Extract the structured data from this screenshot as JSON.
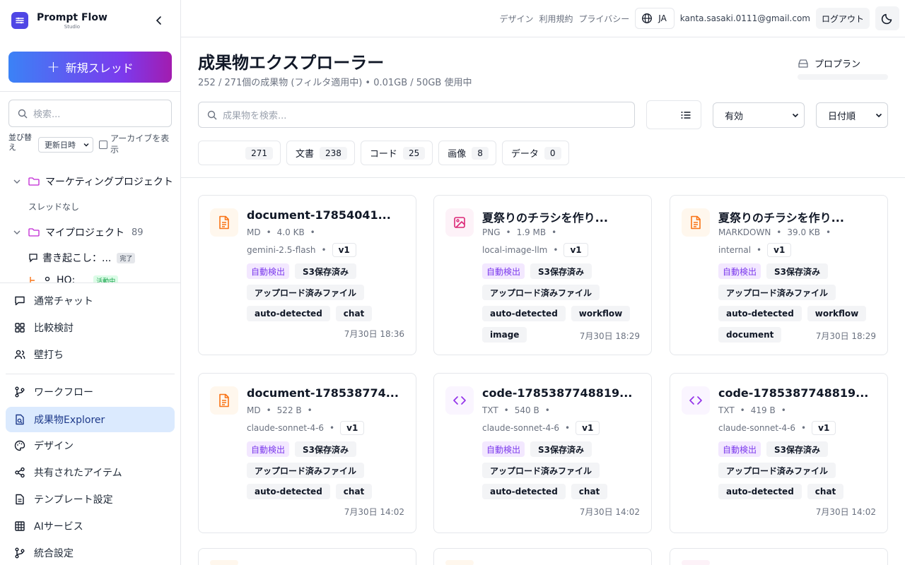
{
  "brand": {
    "title": "Prompt Flow",
    "subtitle": "Studio"
  },
  "sidebar": {
    "new_thread": "新規スレッド",
    "search_placeholder": "検索...",
    "sort_label": "並び替え",
    "sort_value": "更新日時",
    "archive_label": "アーカイブを表示",
    "tree": {
      "folder1": {
        "name": "マーケティングプロジェクト",
        "empty": "スレッドなし"
      },
      "folder2": {
        "name": "マイプロジェクト",
        "count": "89"
      },
      "thread1": {
        "name": "書き起こし：...",
        "badge": "完了"
      },
      "thread2": {
        "name": "HQ:",
        "badge": "活動中"
      }
    },
    "nav": [
      {
        "label": "通常チャット",
        "icon": "chat-icon"
      },
      {
        "label": "比較検討",
        "icon": "grid-icon"
      },
      {
        "label": "壁打ち",
        "icon": "users-icon"
      },
      {
        "label": "ワークフロー",
        "icon": "workflow-icon"
      },
      {
        "label": "成果物Explorer",
        "icon": "artifact-icon"
      },
      {
        "label": "デザイン",
        "icon": "palette-icon"
      },
      {
        "label": "共有されたアイテム",
        "icon": "share-icon"
      },
      {
        "label": "テンプレート設定",
        "icon": "document-icon"
      },
      {
        "label": "AIサービス",
        "icon": "table-icon"
      },
      {
        "label": "統合設定",
        "icon": "branch-icon"
      }
    ]
  },
  "topbar": {
    "links": [
      "デザイン",
      "利用規約",
      "プライバシー"
    ],
    "lang": "JA",
    "email": "kanta.sasaki.0111@gmail.com",
    "logout": "ログアウト"
  },
  "main": {
    "title": "成果物エクスプローラー",
    "subtitle": "252 / 271個の成果物 (フィルタ適用中) • 0.01GB / 50GB 使用中",
    "plan": "プロプラン",
    "search_placeholder": "成果物を検索...",
    "status_filter": "有効",
    "sort": "日付順",
    "filters": [
      {
        "label": "",
        "count": "271"
      },
      {
        "label": "文書",
        "count": "238"
      },
      {
        "label": "コード",
        "count": "25"
      },
      {
        "label": "画像",
        "count": "8"
      },
      {
        "label": "データ",
        "count": "0"
      }
    ],
    "cards": [
      {
        "title": "document-17854041...",
        "type": "MD",
        "size": "4.0 KB",
        "model": "gemini-2.5-flash",
        "version": "v1",
        "tags": [
          "自動検出",
          "S3保存済み",
          "アップロード済みファイル",
          "auto-detected",
          "chat"
        ],
        "date": "7月30日 18:36",
        "icon": "document-icon"
      },
      {
        "title": "夏祭りのチラシを作り...",
        "type": "PNG",
        "size": "1.9 MB",
        "model": "local-image-llm",
        "version": "v1",
        "tags": [
          "自動検出",
          "S3保存済み",
          "アップロード済みファイル",
          "auto-detected",
          "workflow",
          "image"
        ],
        "date": "7月30日 18:29",
        "icon": "image-icon"
      },
      {
        "title": "夏祭りのチラシを作り...",
        "type": "MARKDOWN",
        "size": "39.0 KB",
        "model": "internal",
        "version": "v1",
        "tags": [
          "自動検出",
          "S3保存済み",
          "アップロード済みファイル",
          "auto-detected",
          "workflow",
          "document"
        ],
        "date": "7月30日 18:29",
        "icon": "document-icon"
      },
      {
        "title": "document-178538774...",
        "type": "MD",
        "size": "522 B",
        "model": "claude-sonnet-4-6",
        "version": "v1",
        "tags": [
          "自動検出",
          "S3保存済み",
          "アップロード済みファイル",
          "auto-detected",
          "chat"
        ],
        "date": "7月30日 14:02",
        "icon": "document-icon"
      },
      {
        "title": "code-1785387748819...",
        "type": "TXT",
        "size": "540 B",
        "model": "claude-sonnet-4-6",
        "version": "v1",
        "tags": [
          "自動検出",
          "S3保存済み",
          "アップロード済みファイル",
          "auto-detected",
          "chat"
        ],
        "date": "7月30日 14:02",
        "icon": "code-icon"
      },
      {
        "title": "code-1785387748819...",
        "type": "TXT",
        "size": "419 B",
        "model": "claude-sonnet-4-6",
        "version": "v1",
        "tags": [
          "自動検出",
          "S3保存済み",
          "アップロード済みファイル",
          "auto-detected",
          "chat"
        ],
        "date": "7月30日 14:02",
        "icon": "code-icon"
      }
    ]
  },
  "colors": {
    "accent": "#3b82f6",
    "active_nav": "#dbeafe",
    "doc_icon": "#f97316",
    "image_icon": "#db2777",
    "code_icon": "#9333ea",
    "tag_purple": "#7c3aed"
  }
}
